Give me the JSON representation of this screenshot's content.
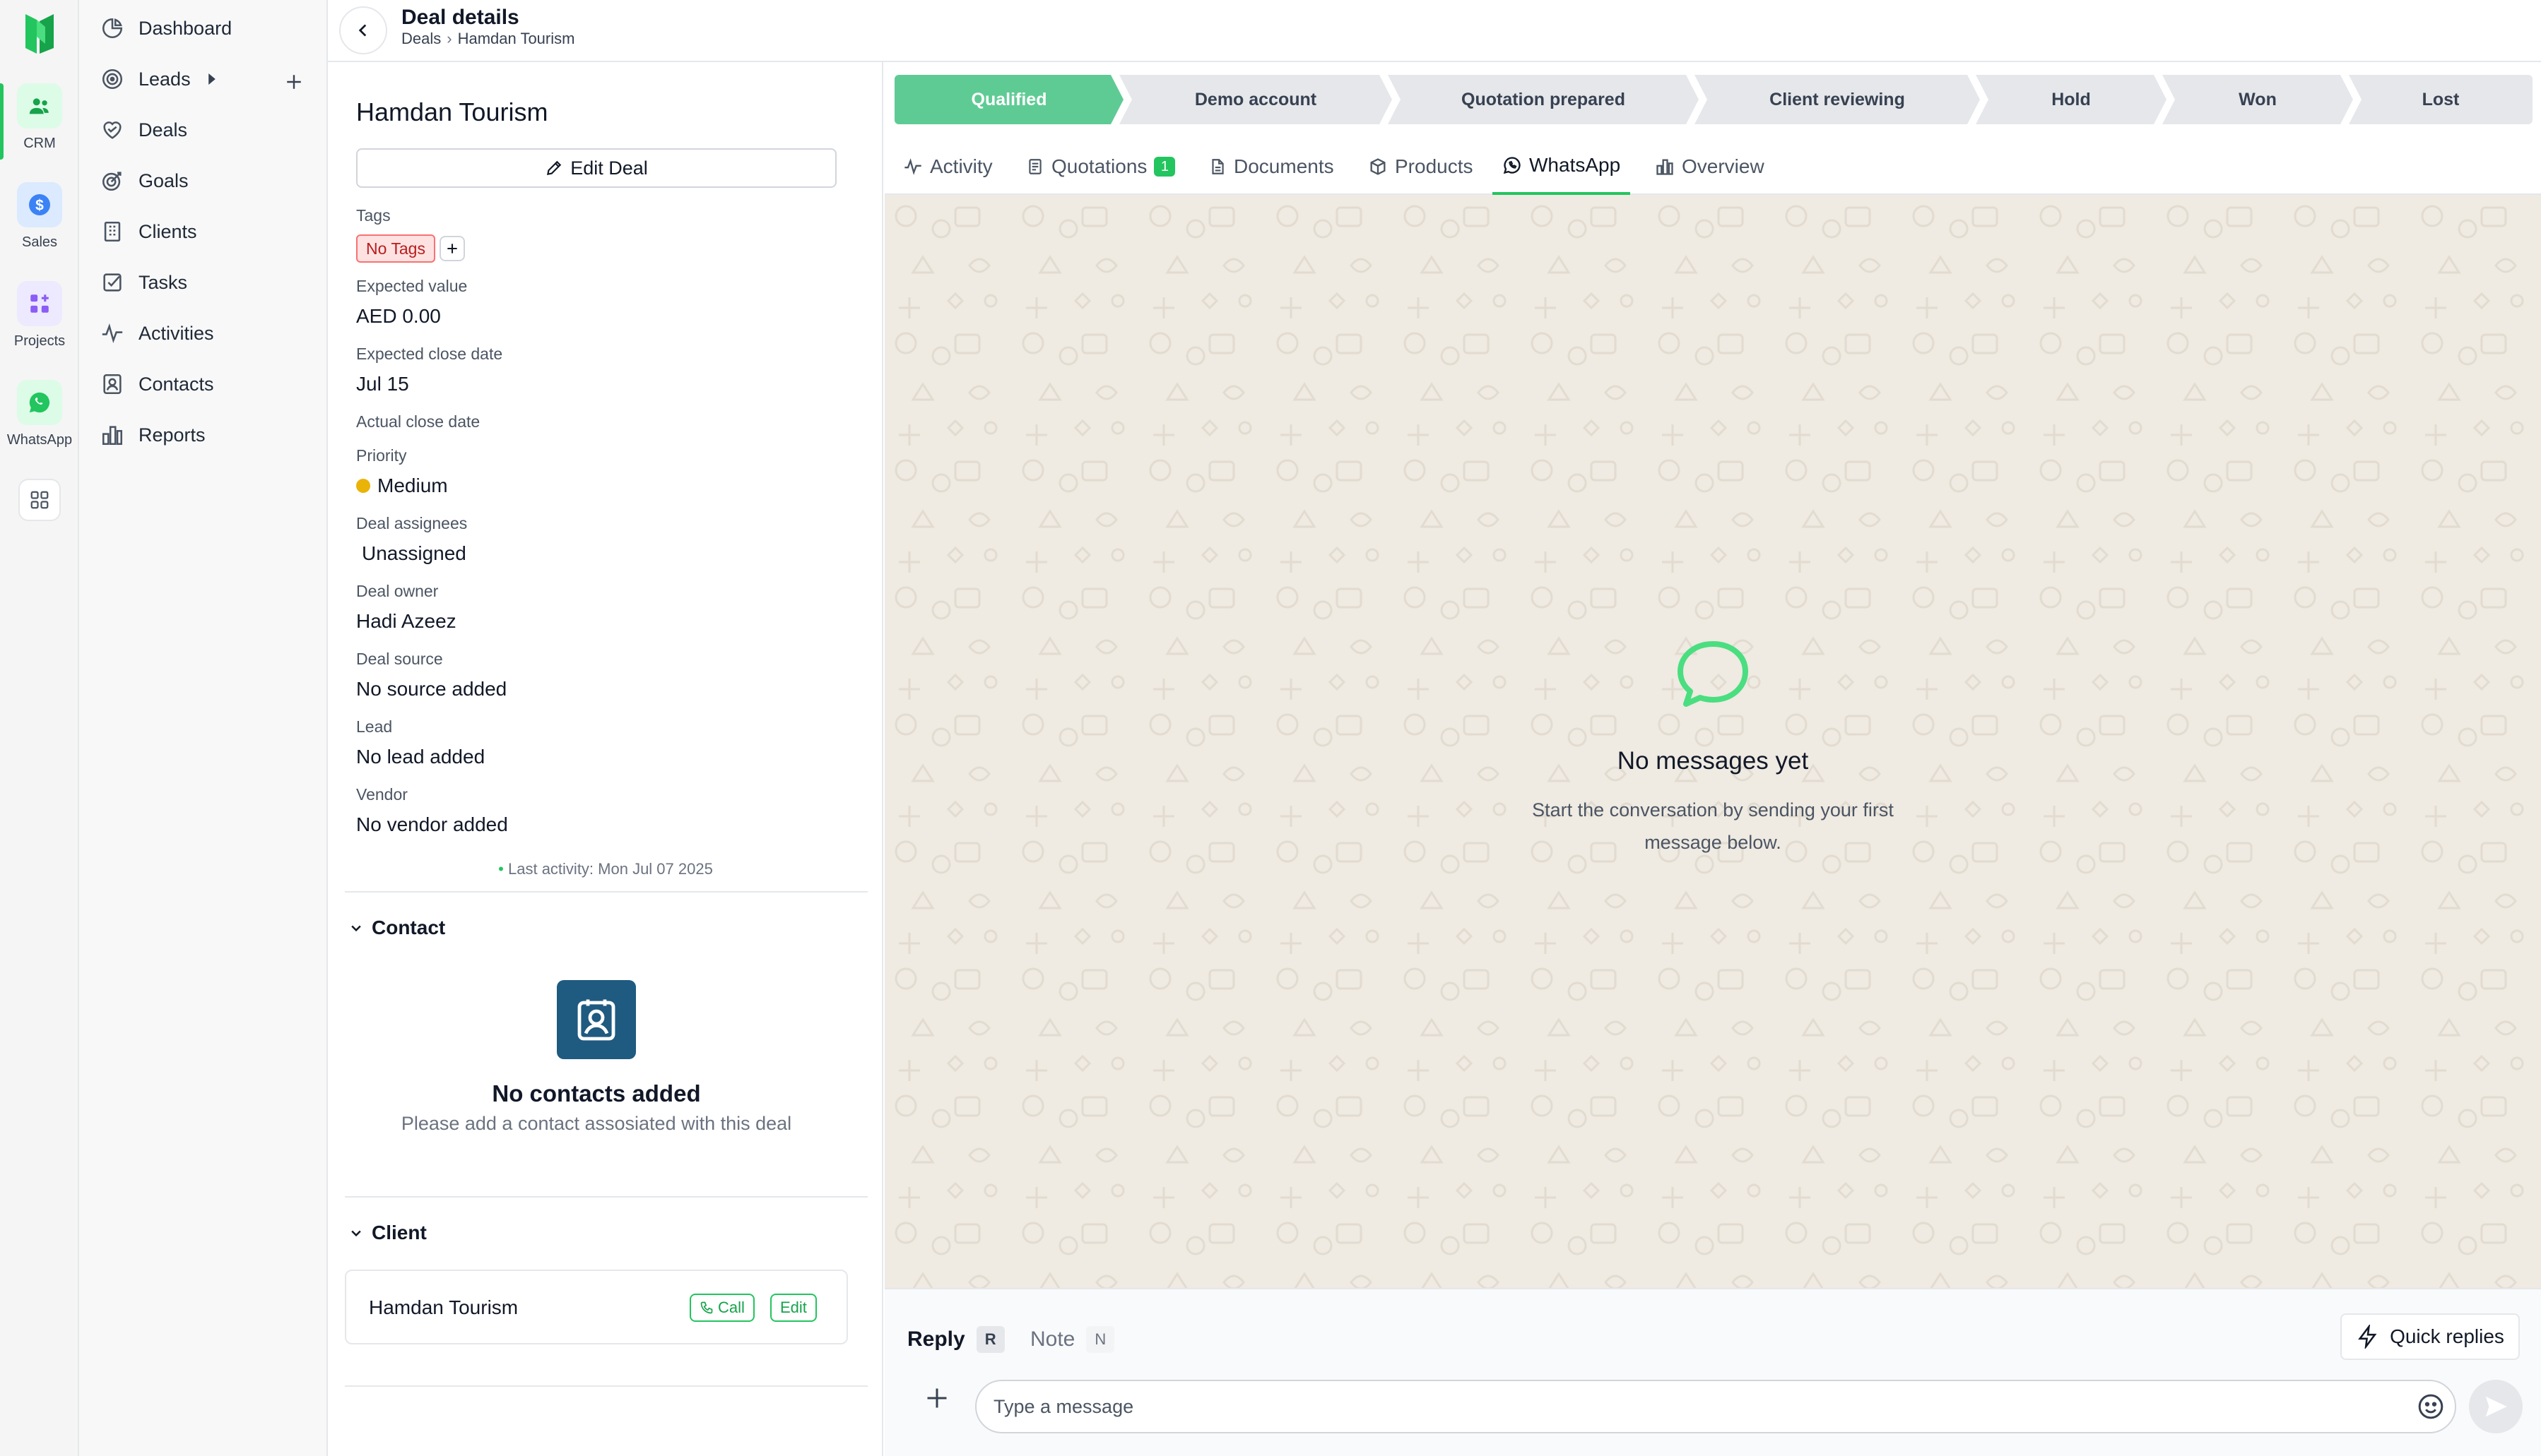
{
  "rail": {
    "items": [
      {
        "label": "CRM",
        "icon": "users-icon",
        "active": true
      },
      {
        "label": "Sales",
        "icon": "dollar-icon"
      },
      {
        "label": "Projects",
        "icon": "grid-plus-icon"
      },
      {
        "label": "WhatsApp",
        "icon": "whatsapp-icon"
      }
    ],
    "apps_icon": "apps-grid-icon",
    "accent": "#22c55e"
  },
  "nav": {
    "items": [
      {
        "label": "Dashboard",
        "icon": "pie-chart-icon"
      },
      {
        "label": "Leads",
        "icon": "target-icon"
      },
      {
        "label": "Deals",
        "icon": "handshake-icon"
      },
      {
        "label": "Goals",
        "icon": "goal-icon"
      },
      {
        "label": "Clients",
        "icon": "building-icon"
      },
      {
        "label": "Tasks",
        "icon": "checkbox-icon"
      },
      {
        "label": "Activities",
        "icon": "activity-icon"
      },
      {
        "label": "Contacts",
        "icon": "contact-icon"
      },
      {
        "label": "Reports",
        "icon": "bar-chart-icon"
      }
    ]
  },
  "header": {
    "title": "Deal details",
    "breadcrumb": {
      "root": "Deals",
      "current": "Hamdan Tourism"
    }
  },
  "deal": {
    "name": "Hamdan Tourism",
    "edit_label": "Edit Deal",
    "tags_label": "Tags",
    "tags_empty": "No Tags",
    "fields": {
      "expected_value": {
        "label": "Expected value",
        "value": "AED 0.00"
      },
      "expected_close": {
        "label": "Expected close date",
        "value": "Jul 15"
      },
      "actual_close": {
        "label": "Actual close date",
        "value": ""
      },
      "priority": {
        "label": "Priority",
        "value": "Medium",
        "color": "#eab308"
      },
      "assignees": {
        "label": "Deal assignees",
        "value": "Unassigned"
      },
      "owner": {
        "label": "Deal owner",
        "value": "Hadi Azeez"
      },
      "source": {
        "label": "Deal source",
        "value": "No source added"
      },
      "lead": {
        "label": "Lead",
        "value": "No lead added"
      },
      "vendor": {
        "label": "Vendor",
        "value": "No vendor added"
      }
    },
    "last_activity": "Last activity: Mon Jul 07 2025"
  },
  "contact": {
    "title": "Contact",
    "empty_title": "No contacts added",
    "empty_sub": "Please add a contact assosiated with this deal"
  },
  "client": {
    "title": "Client",
    "name": "Hamdan Tourism",
    "call_label": "Call",
    "edit_label": "Edit"
  },
  "stages": [
    {
      "label": "Qualified",
      "active": true
    },
    {
      "label": "Demo account"
    },
    {
      "label": "Quotation prepared"
    },
    {
      "label": "Client reviewing"
    },
    {
      "label": "Hold"
    },
    {
      "label": "Won"
    },
    {
      "label": "Lost"
    }
  ],
  "tabs": [
    {
      "label": "Activity",
      "icon": "activity-icon"
    },
    {
      "label": "Quotations",
      "icon": "document-icon",
      "badge": "1"
    },
    {
      "label": "Documents",
      "icon": "file-icon"
    },
    {
      "label": "Products",
      "icon": "box-icon"
    },
    {
      "label": "WhatsApp",
      "icon": "whatsapp-icon",
      "active": true
    },
    {
      "label": "Overview",
      "icon": "bar-chart-icon"
    }
  ],
  "chat": {
    "empty_title": "No messages yet",
    "empty_sub": "Start the conversation by sending your first message below.",
    "background": "#efeae2"
  },
  "composer": {
    "reply_label": "Reply",
    "reply_key": "R",
    "note_label": "Note",
    "note_key": "N",
    "quick_replies": "Quick replies",
    "placeholder": "Type a message"
  }
}
